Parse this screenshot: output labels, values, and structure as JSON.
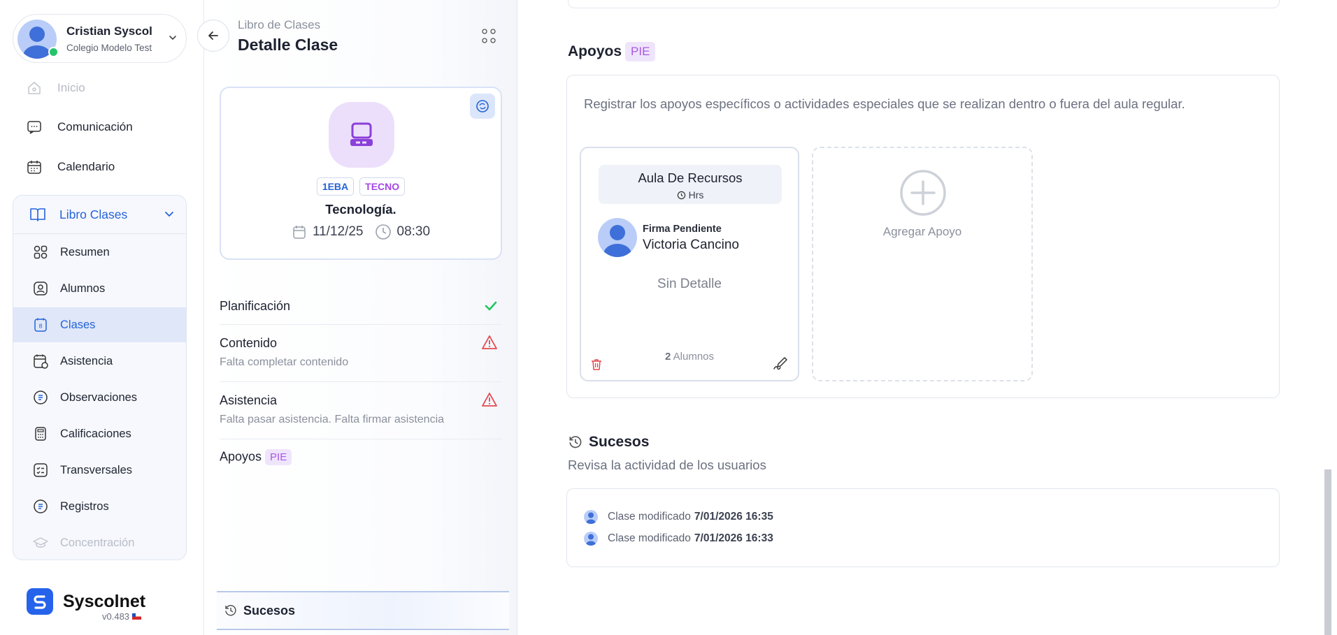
{
  "user": {
    "name": "Cristian Syscol",
    "school": "Colegio Modelo Test"
  },
  "nav": {
    "inicio": "Inicio",
    "comunicacion": "Comunicación",
    "calendario": "Calendario"
  },
  "libro": {
    "label": "Libro Clases",
    "items": [
      "Resumen",
      "Alumnos",
      "Clases",
      "Asistencia",
      "Observaciones",
      "Calificaciones",
      "Transversales",
      "Registros",
      "Concentración"
    ]
  },
  "brand": {
    "name": "Syscolnet",
    "version": "v0.483"
  },
  "header": {
    "breadcrumb": "Libro de Clases",
    "title": "Detalle Clase"
  },
  "class_card": {
    "badges": [
      "1EBA",
      "TECNO"
    ],
    "name": "Tecnología.",
    "date": "11/12/25",
    "time": "08:30"
  },
  "status": {
    "planificacion": {
      "title": "Planificación"
    },
    "contenido": {
      "title": "Contenido",
      "sub": "Falta completar contenido"
    },
    "asistencia": {
      "title": "Asistencia",
      "sub": "Falta pasar asistencia. Falta firmar asistencia"
    },
    "apoyos": {
      "title": "Apoyos",
      "tag": "PIE"
    }
  },
  "tabs": {
    "sucesos": "Sucesos"
  },
  "apoyos_section": {
    "title": "Apoyos",
    "tag": "PIE",
    "description": "Registrar los apoyos específicos o actividades especiales que se realizan dentro o fuera del aula regular.",
    "card": {
      "type": "Aula De Recursos",
      "hours": "Hrs",
      "sign_status": "Firma Pendiente",
      "person": "Victoria Cancino",
      "detail": "Sin Detalle",
      "count": "2",
      "count_label": "Alumnos"
    },
    "add_label": "Agregar Apoyo"
  },
  "sucesos_section": {
    "title": "Sucesos",
    "subtitle": "Revisa la actividad de los usuarios",
    "log": [
      {
        "text": "Clase modificado",
        "date": "7/01/2026 16:35"
      },
      {
        "text": "Clase modificado",
        "date": "7/01/2026 16:33"
      }
    ]
  },
  "colors": {
    "accent": "#2563d9",
    "purple": "#a447e6",
    "warning": "#e5484d",
    "success": "#22c55e"
  }
}
